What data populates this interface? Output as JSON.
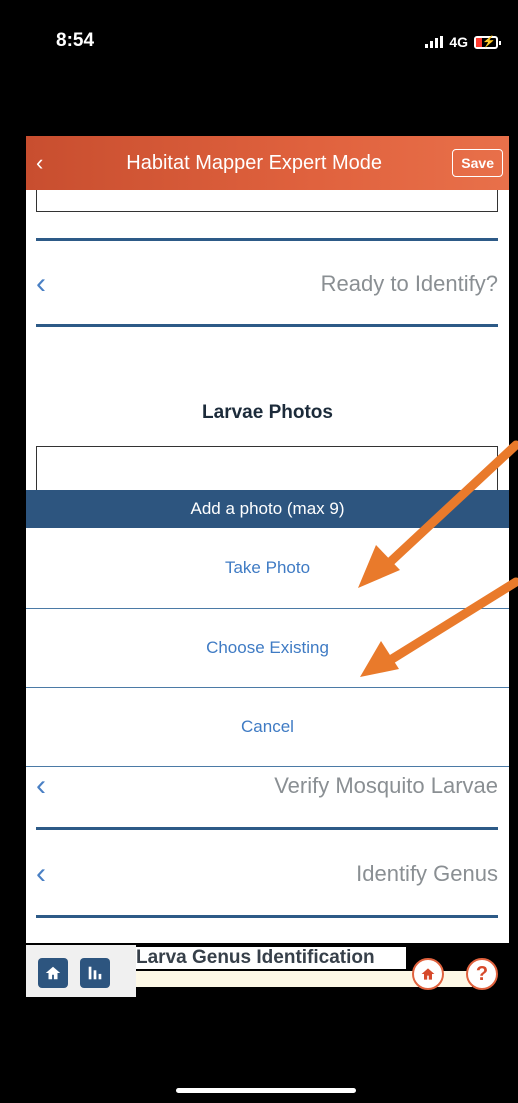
{
  "status_bar": {
    "time": "8:54",
    "network": "4G"
  },
  "header": {
    "title": "Habitat Mapper Expert Mode",
    "save_label": "Save",
    "back_icon": "chevron-left-icon"
  },
  "nav_rows": {
    "ready": {
      "label": "Ready to Identify?"
    },
    "verify": {
      "label": "Verify Mosquito Larvae"
    },
    "genus": {
      "label": "Identify Genus"
    }
  },
  "section": {
    "larvae_photos_title": "Larvae Photos",
    "genus_title": "Larva Genus Identification"
  },
  "action_sheet": {
    "title": "Add a photo (max 9)",
    "items": [
      "Take Photo",
      "Choose Existing",
      "Cancel"
    ]
  },
  "floating_buttons": {
    "home_icon": "home-icon",
    "stats_icon": "bar-chart-icon",
    "help_label": "?"
  },
  "colors": {
    "header_start": "#c84e2f",
    "header_end": "#e8704a",
    "navy": "#2d557f",
    "link_blue": "#3f7bc4",
    "annotation_arrow": "#e97a2b"
  }
}
